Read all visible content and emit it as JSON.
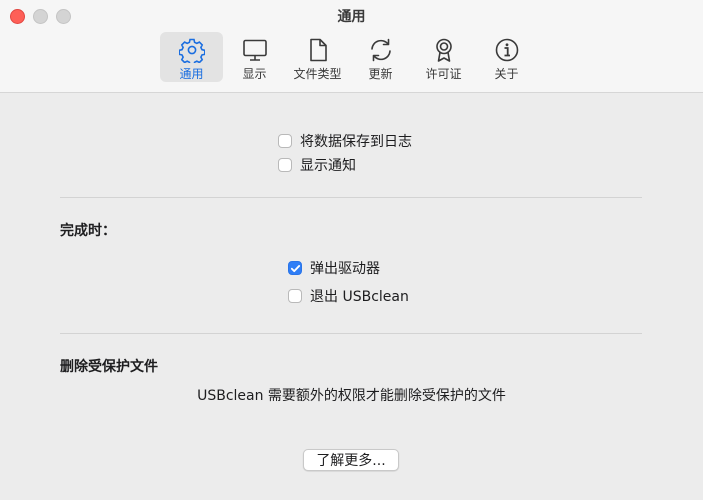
{
  "window": {
    "title": "通用"
  },
  "toolbar": {
    "tabs": [
      {
        "label": "通用",
        "icon": "gear-icon",
        "active": true
      },
      {
        "label": "显示",
        "icon": "display-icon",
        "active": false
      },
      {
        "label": "文件类型",
        "icon": "document-icon",
        "active": false
      },
      {
        "label": "更新",
        "icon": "refresh-icon",
        "active": false
      },
      {
        "label": "许可证",
        "icon": "license-badge-icon",
        "active": false
      },
      {
        "label": "关于",
        "icon": "info-icon",
        "active": false
      }
    ]
  },
  "options": {
    "save_log": {
      "label": "将数据保存到日志",
      "checked": false
    },
    "show_notify": {
      "label": "显示通知",
      "checked": false
    }
  },
  "on_complete": {
    "heading": "完成时：",
    "eject_drive": {
      "label": "弹出驱动器",
      "checked": true
    },
    "quit_app": {
      "label": "退出 USBclean",
      "checked": false
    }
  },
  "protected": {
    "heading": "删除受保护文件",
    "description": "USBclean 需要额外的权限才能删除受保护的文件",
    "learn_more": "了解更多..."
  },
  "colors": {
    "accent": "#2f7ef6",
    "active_tab_text": "#1b6ee0",
    "close_button": "#fe5f57"
  }
}
